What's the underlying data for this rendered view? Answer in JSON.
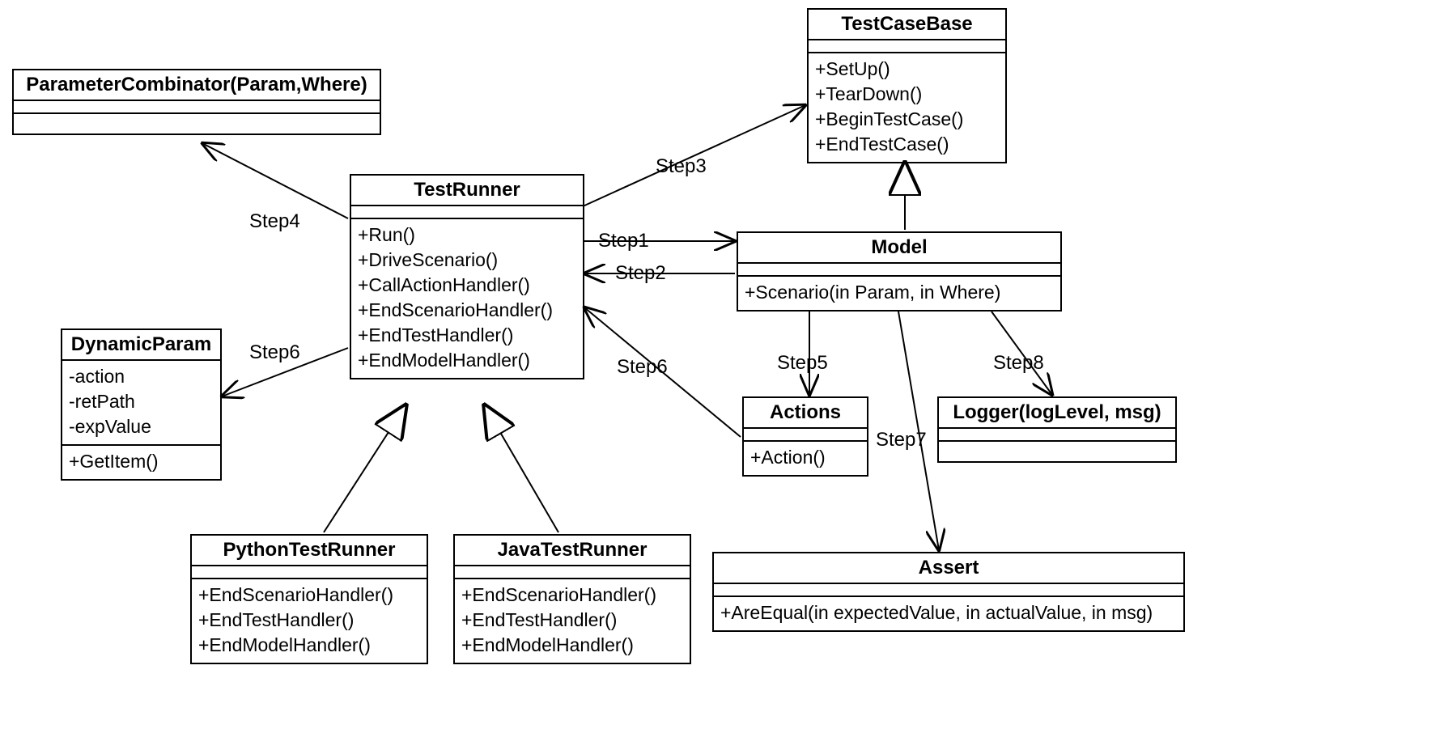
{
  "classes": {
    "parameterCombinator": {
      "name": "ParameterCombinator(Param,Where)",
      "attributes": [],
      "operations": []
    },
    "testCaseBase": {
      "name": "TestCaseBase",
      "attributes": [],
      "operations": [
        "+SetUp()",
        "+TearDown()",
        "+BeginTestCase()",
        "+EndTestCase()"
      ]
    },
    "testRunner": {
      "name": "TestRunner",
      "attributes": [],
      "operations": [
        "+Run()",
        "+DriveScenario()",
        "+CallActionHandler()",
        "+EndScenarioHandler()",
        "+EndTestHandler()",
        "+EndModelHandler()"
      ]
    },
    "dynamicParam": {
      "name": "DynamicParam",
      "attributes": [
        "-action",
        "-retPath",
        "-expValue"
      ],
      "operations": [
        "+GetItem()"
      ]
    },
    "model": {
      "name": "Model",
      "attributes": [],
      "operations": [
        "+Scenario(in Param, in Where)"
      ]
    },
    "actions": {
      "name": "Actions",
      "attributes": [],
      "operations": [
        "+Action()"
      ]
    },
    "logger": {
      "name": "Logger(logLevel, msg)",
      "attributes": [],
      "operations": []
    },
    "pythonTestRunner": {
      "name": "PythonTestRunner",
      "attributes": [],
      "operations": [
        "+EndScenarioHandler()",
        "+EndTestHandler()",
        "+EndModelHandler()"
      ]
    },
    "javaTestRunner": {
      "name": "JavaTestRunner",
      "attributes": [],
      "operations": [
        "+EndScenarioHandler()",
        "+EndTestHandler()",
        "+EndModelHandler()"
      ]
    },
    "assert": {
      "name": "Assert",
      "attributes": [],
      "operations": [
        "+AreEqual(in expectedValue, in actualValue, in msg)"
      ]
    }
  },
  "labels": {
    "step1": "Step1",
    "step2": "Step2",
    "step3": "Step3",
    "step4": "Step4",
    "step5": "Step5",
    "step6a": "Step6",
    "step6b": "Step6",
    "step7": "Step7",
    "step8": "Step8"
  }
}
